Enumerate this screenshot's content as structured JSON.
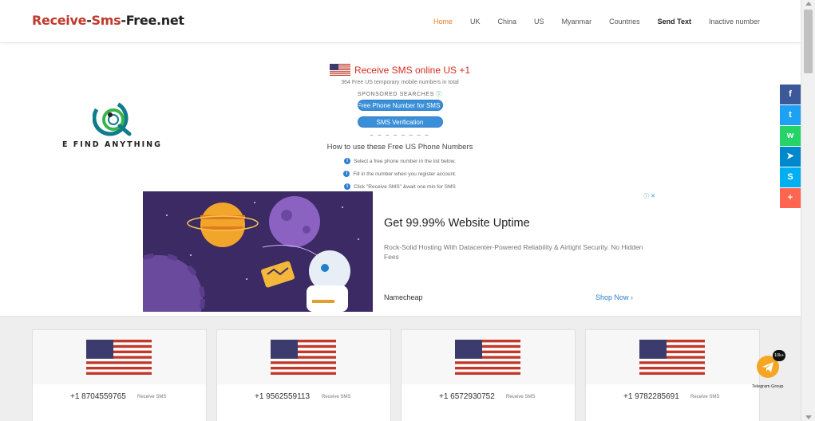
{
  "header": {
    "logo_part1": "Receive",
    "logo_sep1": "-",
    "logo_part2": "Sms",
    "logo_sep2": "-",
    "logo_part3": "Free.net",
    "nav": [
      {
        "label": "Home"
      },
      {
        "label": "UK"
      },
      {
        "label": "China"
      },
      {
        "label": "US"
      },
      {
        "label": "Myanmar"
      },
      {
        "label": "Countries"
      },
      {
        "label": "Send Text"
      },
      {
        "label": "Inactive number"
      }
    ]
  },
  "brand": {
    "text": "E FIND ANYTHING"
  },
  "main": {
    "title": "Receive SMS online US +1",
    "subtitle": "364 Free US temporary mobile numbers in total",
    "sponsored": "SPONSORED SEARCHES",
    "sponsored_mark": "ⓘ",
    "pill1": "Free Phone Number for SMS",
    "pill2": "SMS Verification",
    "how_title": "How to use these Free US Phone Numbers",
    "steps": [
      "Select a free phone number in the list below.",
      "Fill in the number when you register account.",
      "Click \"Receive SMS\" &wait one min for SMS"
    ]
  },
  "ad": {
    "choices": "ⓘ ✕",
    "headline": "Get 99.99% Website Uptime",
    "description": "Rock-Solid Hosting With Datacenter-Powered Reliability & Airtight Security. No Hidden Fees",
    "advertiser": "Namecheap",
    "cta": "Shop Now ›"
  },
  "numbers": [
    {
      "number": "+1 8704559765",
      "action": "Receive SMS"
    },
    {
      "number": "+1 9562559113",
      "action": "Receive SMS"
    },
    {
      "number": "+1 6572930752",
      "action": "Receive SMS"
    },
    {
      "number": "+1 9782285691",
      "action": "Receive SMS"
    }
  ],
  "share": [
    {
      "icon": "facebook-icon",
      "glyph": "f",
      "color": "#3b5998"
    },
    {
      "icon": "twitter-icon",
      "glyph": "t",
      "color": "#1da1f2"
    },
    {
      "icon": "whatsapp-icon",
      "glyph": "w",
      "color": "#25d366"
    },
    {
      "icon": "telegram-icon",
      "glyph": "➤",
      "color": "#0088cc"
    },
    {
      "icon": "skype-icon",
      "glyph": "S",
      "color": "#00aff0"
    },
    {
      "icon": "plus-icon",
      "glyph": "+",
      "color": "#ff6550"
    }
  ],
  "telegram": {
    "badge": "10k+",
    "label": "Telegram Group"
  },
  "colors": {
    "accent_red": "#d62d20",
    "link_blue": "#2a7fd0",
    "nav_active": "#e67e22"
  }
}
